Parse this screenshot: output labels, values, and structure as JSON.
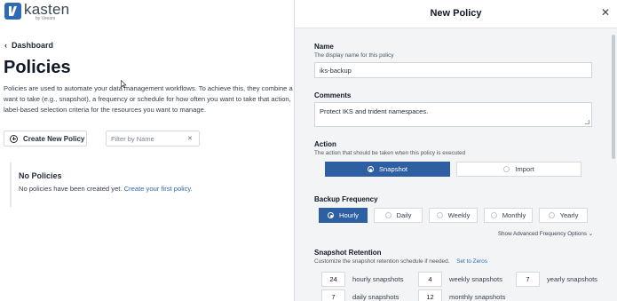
{
  "brand": {
    "name": "kasten",
    "sub": "by Veeam"
  },
  "breadcrumb": {
    "label": "Dashboard"
  },
  "page": {
    "title": "Policies",
    "description": "Policies are used to automate your data management workflows. To achieve this, they combine a want to take (e.g., snapshot), a frequency or schedule for how often you want to take that action, label-based selection criteria for the resources you want to manage."
  },
  "toolbar": {
    "create_label": "Create New Policy",
    "filter_placeholder": "Filter by Name",
    "clear_icon": "close-icon"
  },
  "empty": {
    "title": "No Policies",
    "text": "No policies have been created yet.",
    "link": "Create your first policy."
  },
  "panel": {
    "title": "New Policy",
    "close_icon": "close-icon",
    "name": {
      "label": "Name",
      "help": "The display name for this policy",
      "value": "iks-backup"
    },
    "comments": {
      "label": "Comments",
      "value": "Protect IKS and trident namespaces."
    },
    "action": {
      "label": "Action",
      "help": "The action that should be taken when this policy is executed",
      "options": [
        "Snapshot",
        "Import"
      ],
      "selected": "Snapshot"
    },
    "frequency": {
      "label": "Backup Frequency",
      "options": [
        "Hourly",
        "Daily",
        "Weekly",
        "Monthly",
        "Yearly"
      ],
      "selected": "Hourly",
      "advanced": "Show Advanced Frequency Options ⌄"
    },
    "retention": {
      "label": "Snapshot Retention",
      "help": "Customize the snapshot retention schedule if needed.",
      "reset": "Set to Zeros",
      "hourly": {
        "value": "24",
        "label": "hourly snapshots"
      },
      "weekly": {
        "value": "4",
        "label": "weekly snapshots"
      },
      "yearly": {
        "value": "7",
        "label": "yearly snapshots"
      },
      "daily": {
        "value": "7",
        "label": "daily snapshots"
      },
      "monthly": {
        "value": "12",
        "label": "monthly snapshots"
      }
    }
  },
  "colors": {
    "accent": "#2f5fa3",
    "link": "#2f6ab3",
    "panel_bg": "#f3f4f6"
  }
}
